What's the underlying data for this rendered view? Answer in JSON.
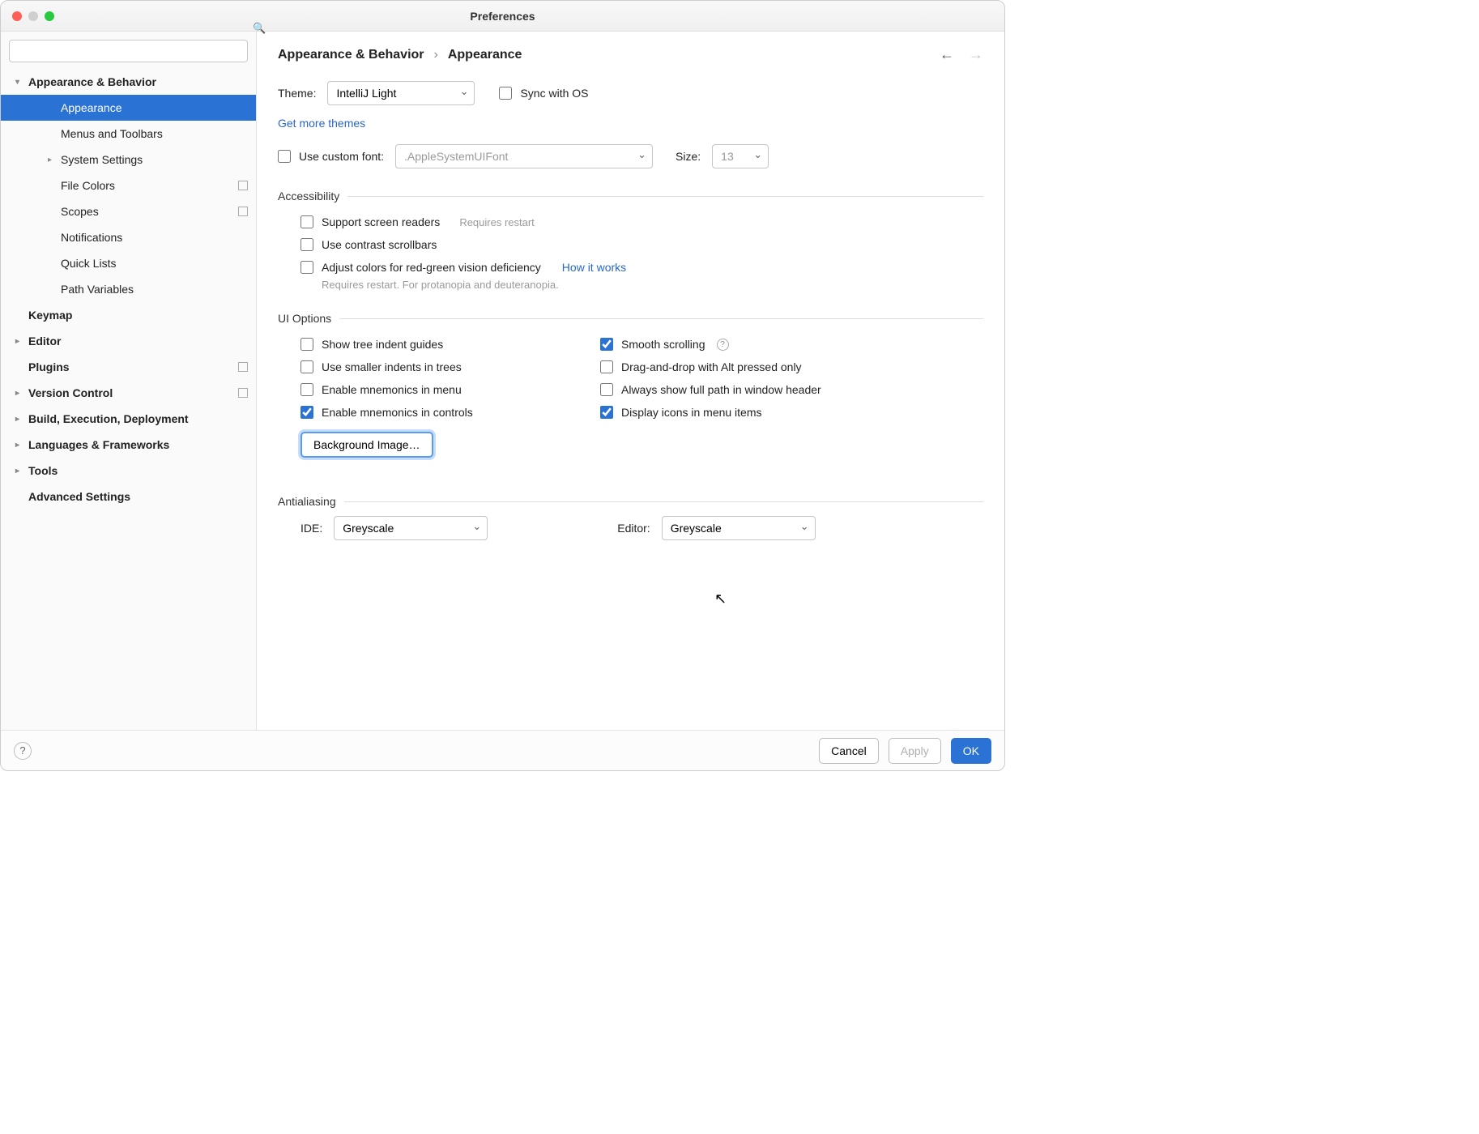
{
  "window": {
    "title": "Preferences"
  },
  "breadcrumb": {
    "parent": "Appearance & Behavior",
    "sep": "›",
    "current": "Appearance"
  },
  "sidebar": {
    "items": [
      {
        "label": "Appearance & Behavior",
        "bold": true,
        "arrow": "open",
        "lvl": 0
      },
      {
        "label": "Appearance",
        "lvl": 1,
        "selected": true
      },
      {
        "label": "Menus and Toolbars",
        "lvl": 1
      },
      {
        "label": "System Settings",
        "lvl": 1,
        "arrow": "closed"
      },
      {
        "label": "File Colors",
        "lvl": 1,
        "badge": true
      },
      {
        "label": "Scopes",
        "lvl": 1,
        "badge": true
      },
      {
        "label": "Notifications",
        "lvl": 1
      },
      {
        "label": "Quick Lists",
        "lvl": 1
      },
      {
        "label": "Path Variables",
        "lvl": 1
      },
      {
        "label": "Keymap",
        "bold": true,
        "lvl": 0,
        "arrow": "empty"
      },
      {
        "label": "Editor",
        "bold": true,
        "lvl": 0,
        "arrow": "closed"
      },
      {
        "label": "Plugins",
        "bold": true,
        "lvl": 0,
        "arrow": "empty",
        "badge": true
      },
      {
        "label": "Version Control",
        "bold": true,
        "lvl": 0,
        "arrow": "closed",
        "badge": true
      },
      {
        "label": "Build, Execution, Deployment",
        "bold": true,
        "lvl": 0,
        "arrow": "closed"
      },
      {
        "label": "Languages & Frameworks",
        "bold": true,
        "lvl": 0,
        "arrow": "closed"
      },
      {
        "label": "Tools",
        "bold": true,
        "lvl": 0,
        "arrow": "closed"
      },
      {
        "label": "Advanced Settings",
        "bold": true,
        "lvl": 0,
        "arrow": "empty"
      }
    ]
  },
  "theme": {
    "label": "Theme:",
    "value": "IntelliJ Light",
    "sync": "Sync with OS",
    "more": "Get more themes"
  },
  "font": {
    "useCustom": "Use custom font:",
    "family": ".AppleSystemUIFont",
    "sizeLabel": "Size:",
    "size": "13"
  },
  "sections": {
    "accessibility": {
      "title": "Accessibility",
      "screenReaders": "Support screen readers",
      "requiresRestart": "Requires restart",
      "contrastScroll": "Use contrast scrollbars",
      "colorDef": "Adjust colors for red-green vision deficiency",
      "howItWorks": "How it works",
      "colorDefNote": "Requires restart. For protanopia and deuteranopia."
    },
    "uiOptions": {
      "title": "UI Options",
      "treeIndent": "Show tree indent guides",
      "smallerIndents": "Use smaller indents in trees",
      "mnemonicsMenu": "Enable mnemonics in menu",
      "mnemonicsControls": "Enable mnemonics in controls",
      "smoothScroll": "Smooth scrolling",
      "dragDrop": "Drag-and-drop with Alt pressed only",
      "fullPath": "Always show full path in window header",
      "displayIcons": "Display icons in menu items",
      "bgImage": "Background Image…"
    },
    "antialiasing": {
      "title": "Antialiasing",
      "ideLabel": "IDE:",
      "ideValue": "Greyscale",
      "editorLabel": "Editor:",
      "editorValue": "Greyscale"
    }
  },
  "footer": {
    "cancel": "Cancel",
    "apply": "Apply",
    "ok": "OK"
  }
}
